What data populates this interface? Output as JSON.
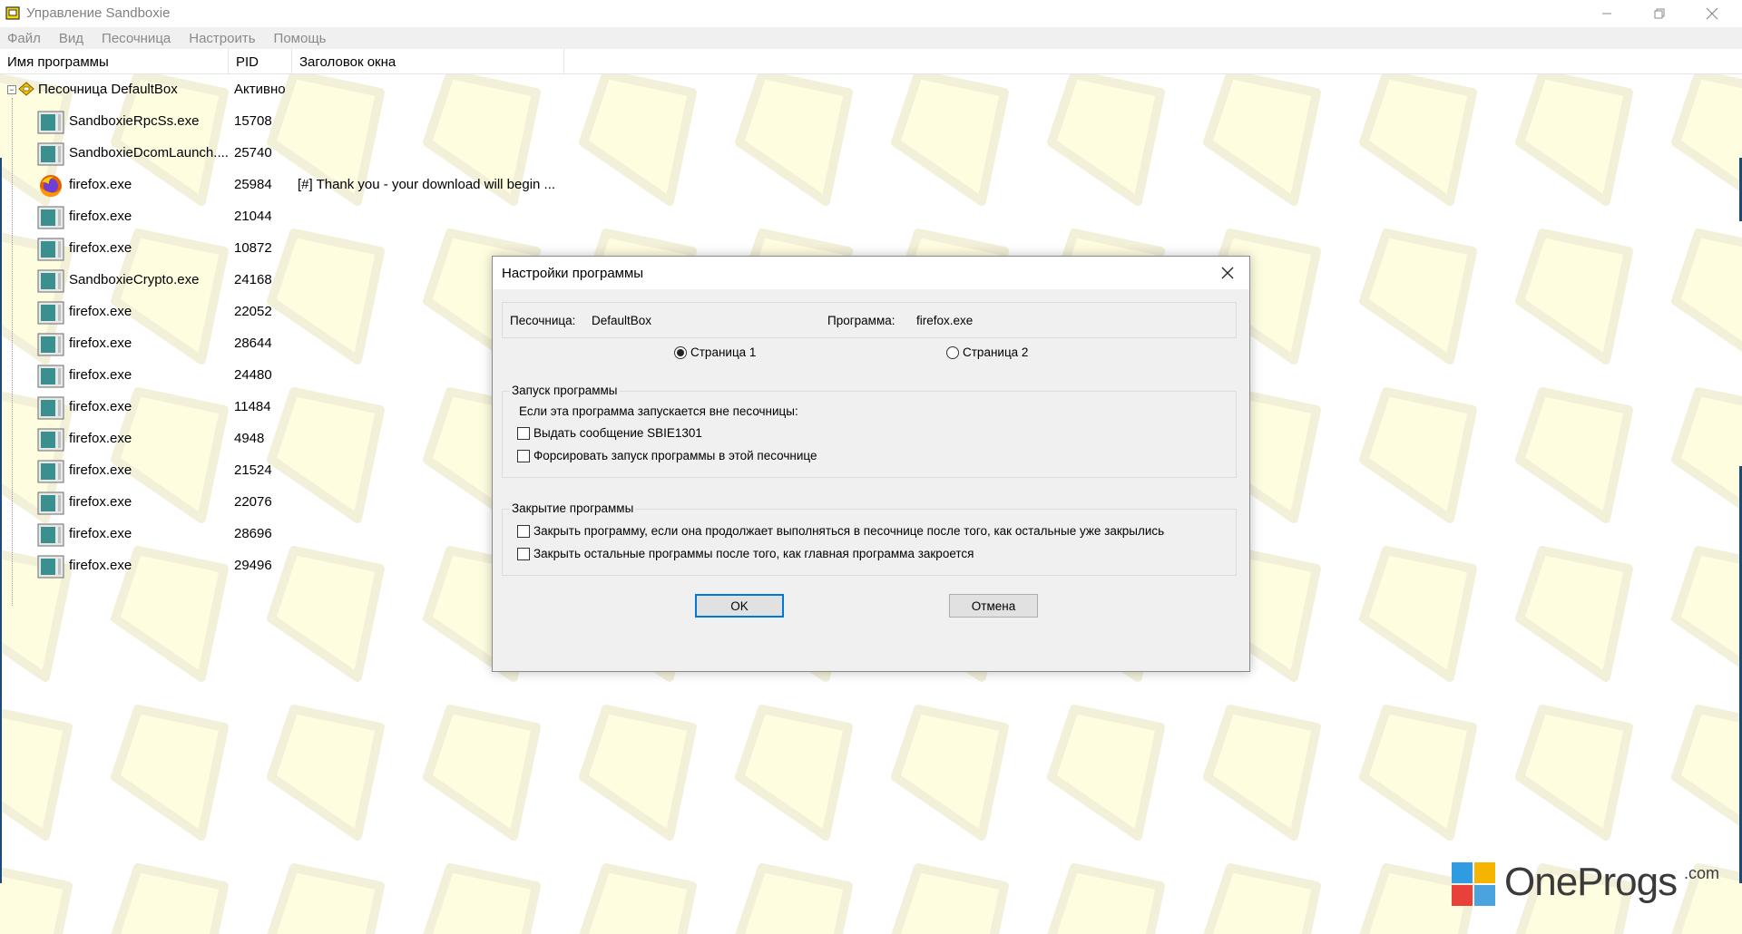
{
  "window": {
    "title": "Управление Sandboxie"
  },
  "menu": [
    "Файл",
    "Вид",
    "Песочница",
    "Настроить",
    "Помощь"
  ],
  "columns": {
    "name": "Имя программы",
    "pid": "PID",
    "title": "Заголовок окна"
  },
  "sandbox": {
    "name": "Песочница DefaultBox",
    "status": "Активно"
  },
  "processes": [
    {
      "name": "SandboxieRpcSs.exe",
      "pid": "15708",
      "title": "",
      "icon": "generic-exe-icon"
    },
    {
      "name": "SandboxieDcomLaunch....",
      "pid": "25740",
      "title": "",
      "icon": "generic-exe-icon"
    },
    {
      "name": "firefox.exe",
      "pid": "25984",
      "title": "[#] Thank you - your download will begin ...",
      "icon": "firefox-icon"
    },
    {
      "name": "firefox.exe",
      "pid": "21044",
      "title": "",
      "icon": "generic-exe-icon"
    },
    {
      "name": "firefox.exe",
      "pid": "10872",
      "title": "",
      "icon": "generic-exe-icon"
    },
    {
      "name": "SandboxieCrypto.exe",
      "pid": "24168",
      "title": "",
      "icon": "generic-exe-icon"
    },
    {
      "name": "firefox.exe",
      "pid": "22052",
      "title": "",
      "icon": "generic-exe-icon"
    },
    {
      "name": "firefox.exe",
      "pid": "28644",
      "title": "",
      "icon": "generic-exe-icon"
    },
    {
      "name": "firefox.exe",
      "pid": "24480",
      "title": "",
      "icon": "generic-exe-icon"
    },
    {
      "name": "firefox.exe",
      "pid": "11484",
      "title": "",
      "icon": "generic-exe-icon"
    },
    {
      "name": "firefox.exe",
      "pid": "4948",
      "title": "",
      "icon": "generic-exe-icon"
    },
    {
      "name": "firefox.exe",
      "pid": "21524",
      "title": "",
      "icon": "generic-exe-icon"
    },
    {
      "name": "firefox.exe",
      "pid": "22076",
      "title": "",
      "icon": "generic-exe-icon"
    },
    {
      "name": "firefox.exe",
      "pid": "28696",
      "title": "",
      "icon": "generic-exe-icon"
    },
    {
      "name": "firefox.exe",
      "pid": "29496",
      "title": "",
      "icon": "generic-exe-icon"
    }
  ],
  "dialog": {
    "title": "Настройки программы",
    "sandbox_label": "Песочница:",
    "sandbox_value": "DefaultBox",
    "program_label": "Программа:",
    "program_value": "firefox.exe",
    "page1": "Страница 1",
    "page2": "Страница 2",
    "page_selected": 1,
    "launch_group": {
      "title": "Запуск программы",
      "hint": "Если эта программа запускается вне песочницы:",
      "options": [
        {
          "label": "Выдать сообщение SBIE1301",
          "checked": false
        },
        {
          "label": "Форсировать запуск программы в этой песочнице",
          "checked": false
        }
      ]
    },
    "close_group": {
      "title": "Закрытие программы",
      "options": [
        {
          "label": "Закрыть программу, если она продолжает выполняться в песочнице после того, как остальные уже закрылись",
          "checked": false
        },
        {
          "label": "Закрыть остальные программы после того, как главная программа закроется",
          "checked": false
        }
      ]
    },
    "ok": "OK",
    "cancel": "Отмена"
  },
  "watermark": {
    "name": "OneProgs",
    "suffix": ".com"
  },
  "colors": {
    "pattern_fill": "#fffde0",
    "pattern_stroke": "#f2f0d8",
    "focus_border": "#0078d7",
    "dialog_bg": "#f0f0f0"
  }
}
